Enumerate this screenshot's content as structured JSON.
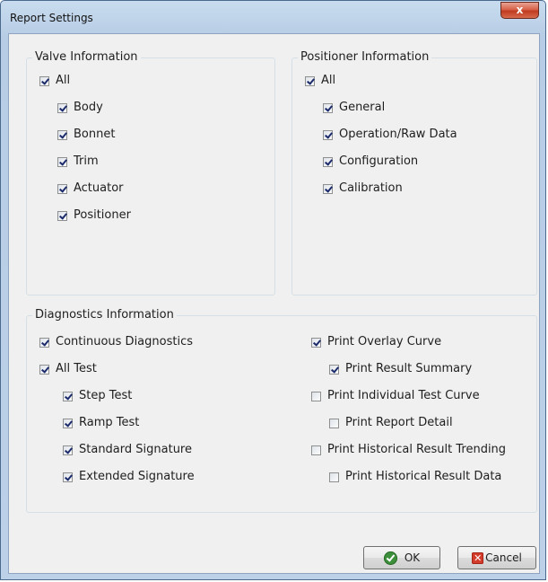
{
  "window": {
    "title": "Report Settings",
    "close_label": "x"
  },
  "valve": {
    "title": "Valve Information",
    "all_label": "All",
    "all_checked": true,
    "items": [
      {
        "label": "Body",
        "checked": true
      },
      {
        "label": "Bonnet",
        "checked": true
      },
      {
        "label": "Trim",
        "checked": true
      },
      {
        "label": "Actuator",
        "checked": true
      },
      {
        "label": "Positioner",
        "checked": true
      }
    ]
  },
  "positioner": {
    "title": "Positioner Information",
    "all_label": "All",
    "all_checked": true,
    "items": [
      {
        "label": "General",
        "checked": true
      },
      {
        "label": "Operation/Raw Data",
        "checked": true
      },
      {
        "label": "Configuration",
        "checked": true
      },
      {
        "label": "Calibration",
        "checked": true
      }
    ]
  },
  "diagnostics": {
    "title": "Diagnostics Information",
    "left": [
      {
        "label": "Continuous Diagnostics",
        "checked": true
      },
      {
        "label": "All Test",
        "checked": true
      },
      {
        "label": "Step Test",
        "checked": true
      },
      {
        "label": "Ramp Test",
        "checked": true
      },
      {
        "label": "Standard Signature",
        "checked": true
      },
      {
        "label": "Extended Signature",
        "checked": true
      }
    ],
    "right": [
      {
        "label": "Print Overlay Curve",
        "checked": true
      },
      {
        "label": "Print Result Summary",
        "checked": true
      },
      {
        "label": "Print Individual Test Curve",
        "checked": false
      },
      {
        "label": "Print Report Detail",
        "checked": false
      },
      {
        "label": "Print Historical Result Trending",
        "checked": false
      },
      {
        "label": "Print Historical Result Data",
        "checked": false
      }
    ]
  },
  "buttons": {
    "ok_label": "OK",
    "cancel_label": "Cancel"
  },
  "colors": {
    "ok_icon": "#3d8f3b",
    "cancel_icon": "#d33b2b",
    "title_bar": "#c9dcef"
  }
}
